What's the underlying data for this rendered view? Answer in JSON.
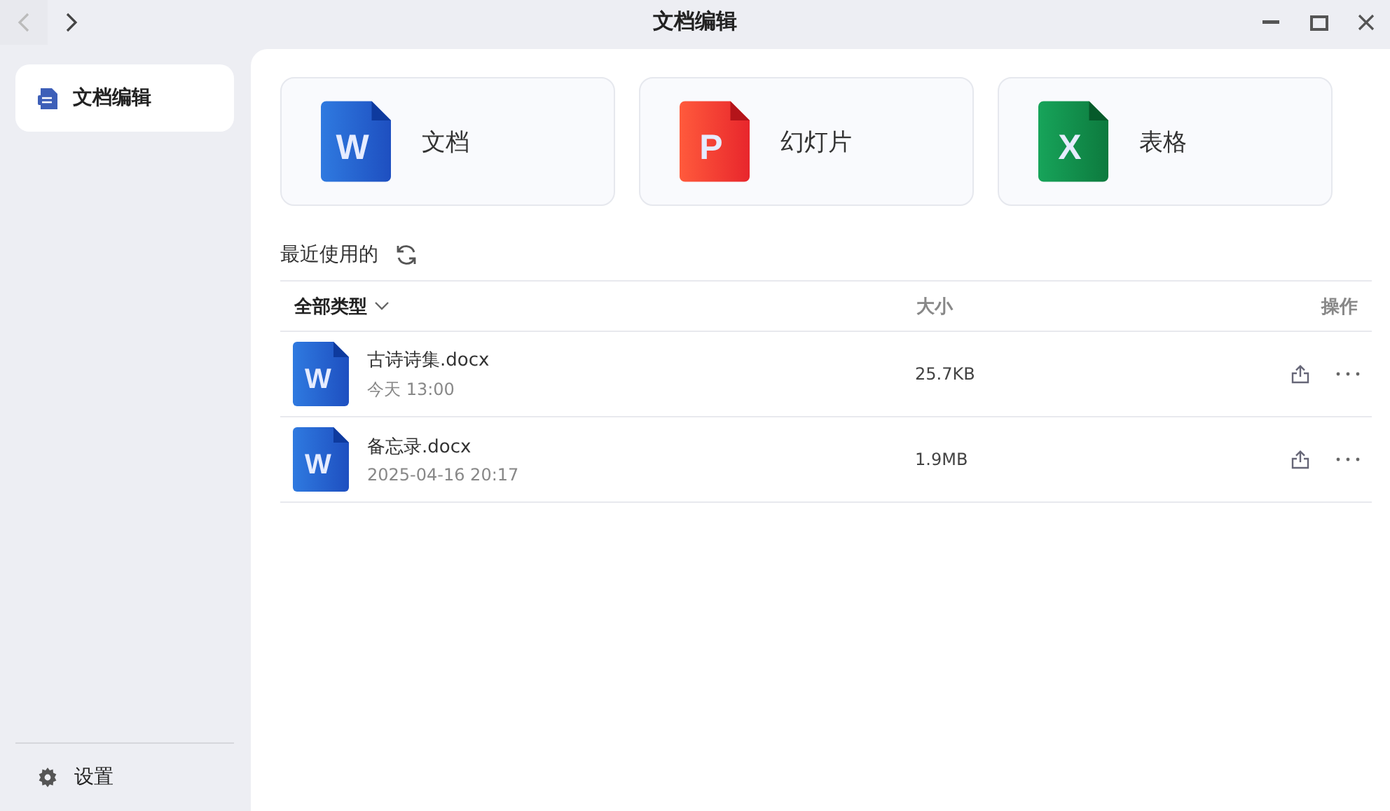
{
  "window": {
    "title": "文档编辑",
    "back_disabled": true,
    "forward_disabled": false
  },
  "sidebar": {
    "items": [
      {
        "label": "文档编辑",
        "selected": true
      }
    ],
    "footer": {
      "label": "设置"
    }
  },
  "create_cards": [
    {
      "kind": "word",
      "letter": "W",
      "label": "文档"
    },
    {
      "kind": "slides",
      "letter": "P",
      "label": "幻灯片"
    },
    {
      "kind": "sheet",
      "letter": "X",
      "label": "表格"
    }
  ],
  "recent": {
    "title": "最近使用的",
    "columns": [
      {
        "label": "全部类型"
      },
      {
        "label": "大小"
      },
      {
        "label": "操作"
      }
    ],
    "rows": [
      {
        "kind": "word",
        "letter": "W",
        "name": "古诗诗集.docx",
        "time": "今天 13:00",
        "size": "25.7KB"
      },
      {
        "kind": "word",
        "letter": "W",
        "name": "备忘录.docx",
        "time": "2025-04-16 20:17",
        "size": "1.9MB"
      }
    ]
  }
}
